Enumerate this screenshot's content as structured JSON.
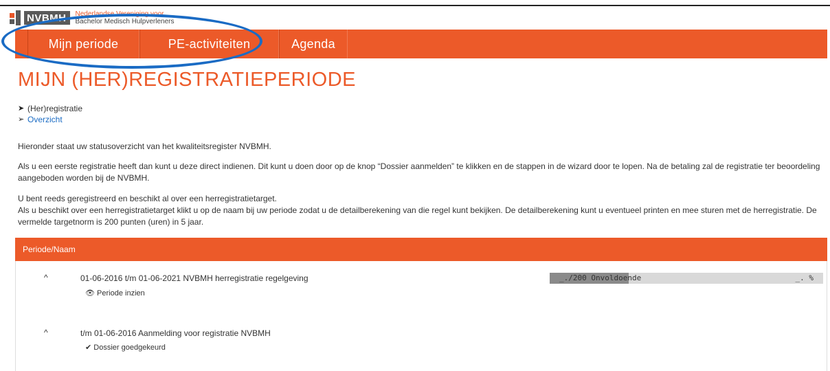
{
  "brand": {
    "logo_text": "NVBMH",
    "tagline_line1": "Nederlandse Vereniging voor",
    "tagline_line2": "Bachelor Medisch Hulpverleners",
    "accent_color": "#ec5a29",
    "annotation_color": "#1a6bc4"
  },
  "nav": {
    "items": [
      {
        "label": "Mijn periode"
      },
      {
        "label": "PE-activiteiten"
      },
      {
        "label": "Agenda"
      }
    ]
  },
  "page": {
    "title": "MIJN (HER)REGISTRATIEPERIODE",
    "breadcrumb": [
      {
        "label": "(Her)registratie",
        "icon": "arrow-right-filled-icon"
      },
      {
        "label": "Overzicht",
        "icon": "arrow-right-outline-icon"
      }
    ],
    "intro": "Hieronder staat uw statusoverzicht van het kwaliteitsregister NVBMH.",
    "para_registration": "Als u een eerste registratie heeft dan kunt u deze direct indienen. Dit kunt u doen door op de knop “Dossier aanmelden” te klikken en de stappen in de wizard door te lopen. Na de betaling zal de registratie ter beoordeling aangeboden worden bij de NVBMH.",
    "para_registered_line1": "U bent reeds geregistreerd en beschikt al over een herregistratietarget.",
    "para_registered_line2": "Als u beschikt over een herregistratietarget klikt u op de naam bij uw periode zodat u de detailberekening van die regel kunt bekijken. De detailberekening kunt u eventueel printen en mee sturen met de herregistratie. De vermelde targetnorm is 200 punten (uren) in 5 jaar."
  },
  "table": {
    "header": "Periode/Naam",
    "rows": [
      {
        "caret": "^",
        "title": "01-06-2016 t/m 01-06-2021 NVBMH herregistratie regelgeving",
        "action_icon": "eye-icon",
        "action_label": "Periode inzien",
        "progress_label": "_./200 Onvoldoende",
        "progress_pct": "_. %",
        "progress_fraction": 0.29
      },
      {
        "caret": "^",
        "title": "t/m 01-06-2016 Aanmelding voor registratie NVBMH",
        "action_icon": "checkmark-icon",
        "action_label": "Dossier goedgekeurd"
      }
    ]
  }
}
